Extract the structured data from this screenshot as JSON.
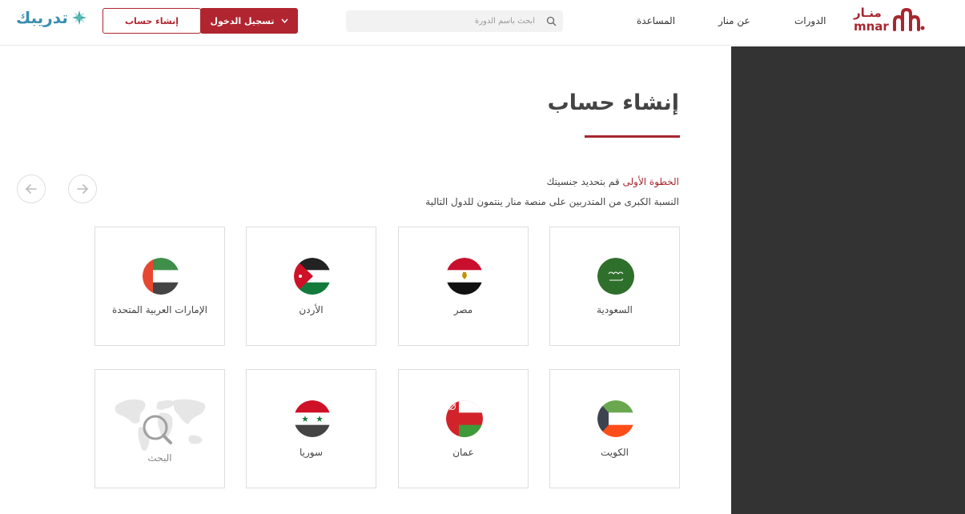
{
  "header": {
    "brand_left": "تدريبك",
    "register_label": "إنشاء حساب",
    "login_label": "تسجيل الدخول",
    "search_placeholder": "ابحث باسم الدورة",
    "nav": [
      "المساعدة",
      "عن منار",
      "الدورات"
    ],
    "brand_right_ar": "منـار",
    "brand_right_en": "mnar"
  },
  "main": {
    "title": "إنشاء حساب",
    "step_highlight": "الخطوة الأولى",
    "step_text": "قم بتحديد جنسيتك",
    "subtitle": "النسبة الكبرى من المتدربين على منصة منار ينتمون للدول التالية"
  },
  "countries": [
    {
      "name": "السعودية",
      "flag": "saudi-flag-icon"
    },
    {
      "name": "مصر",
      "flag": "egypt-flag-icon"
    },
    {
      "name": "الأردن",
      "flag": "jordan-flag-icon"
    },
    {
      "name": "الإمارات العربية المتحدة",
      "flag": "uae-flag-icon"
    },
    {
      "name": "الكويت",
      "flag": "kuwait-flag-icon"
    },
    {
      "name": "عمان",
      "flag": "oman-flag-icon"
    },
    {
      "name": "سوريا",
      "flag": "syria-flag-icon"
    },
    {
      "name": "البحث",
      "flag": "world-search-icon"
    }
  ],
  "colors": {
    "accent": "#b0252f",
    "panel": "#333333",
    "brand_left": "#3a8fb0"
  }
}
